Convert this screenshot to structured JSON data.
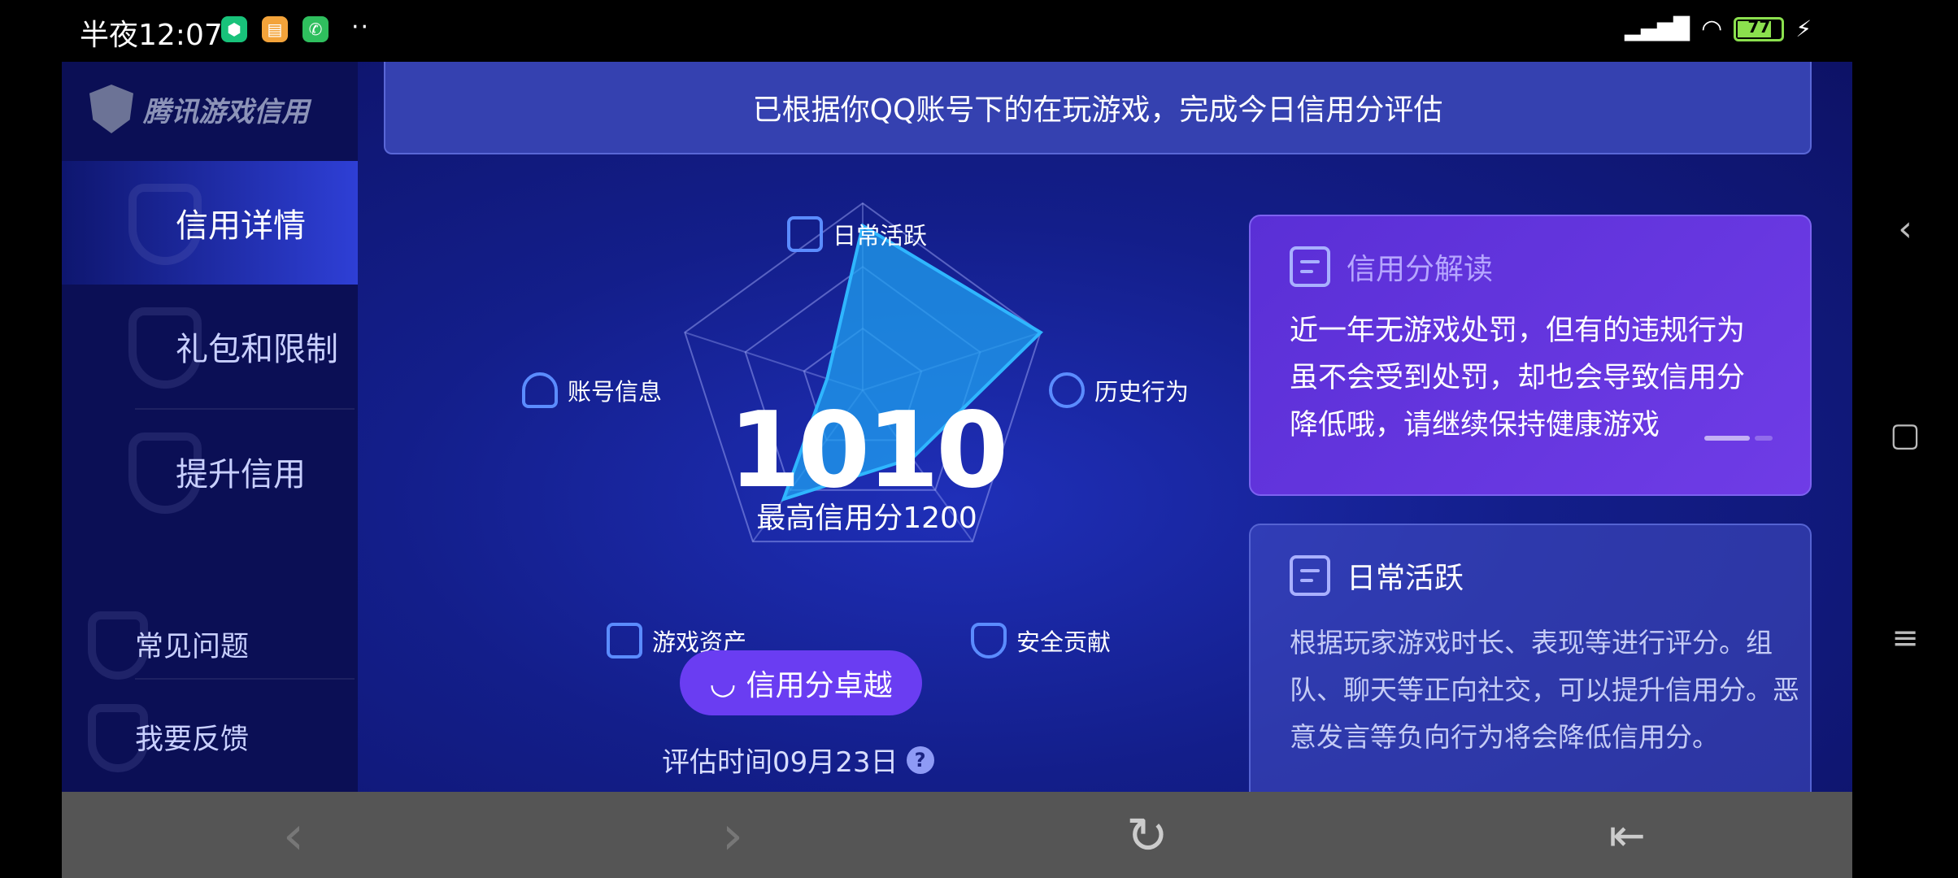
{
  "statusbar": {
    "time": "半夜12:07",
    "battery": "77"
  },
  "sidebar": {
    "logo": "腾讯游戏信用",
    "items": [
      {
        "label": "信用详情"
      },
      {
        "label": "礼包和限制"
      },
      {
        "label": "提升信用"
      },
      {
        "label": "常见问题"
      },
      {
        "label": "我要反馈"
      }
    ]
  },
  "banner": {
    "text": "已根据你QQ账号下的在玩游戏，完成今日信用分评估"
  },
  "radar": {
    "score": "1010",
    "max_text": "最高信用分1200",
    "labels": {
      "daily": "日常活跃",
      "history": "历史行为",
      "security": "安全贡献",
      "assets": "游戏资产",
      "account": "账号信息"
    },
    "values_fraction": {
      "daily": 0.88,
      "history": 1.0,
      "security": 0.45,
      "assets": 0.72,
      "account": 0.2
    },
    "level_button": "信用分卓越",
    "eval_time": "评估时间09月23日",
    "help": "?"
  },
  "card1": {
    "title": "信用分解读",
    "body": [
      "近一年无游戏处罚，但有的违规行为",
      "虽不会受到处罚，却也会导致信用分",
      "降低哦，请继续保持健康游戏"
    ]
  },
  "card2": {
    "title": "日常活跃",
    "body": [
      "根据玩家游戏时长、表现等进行评分。组",
      "队、聊天等正向社交，可以提升信用分。恶",
      "意发言等负向行为将会降低信用分。"
    ]
  },
  "colors": {
    "accent": "#6a3df2",
    "radar_fill": "#1fa0f0",
    "background": "#131e8a"
  }
}
